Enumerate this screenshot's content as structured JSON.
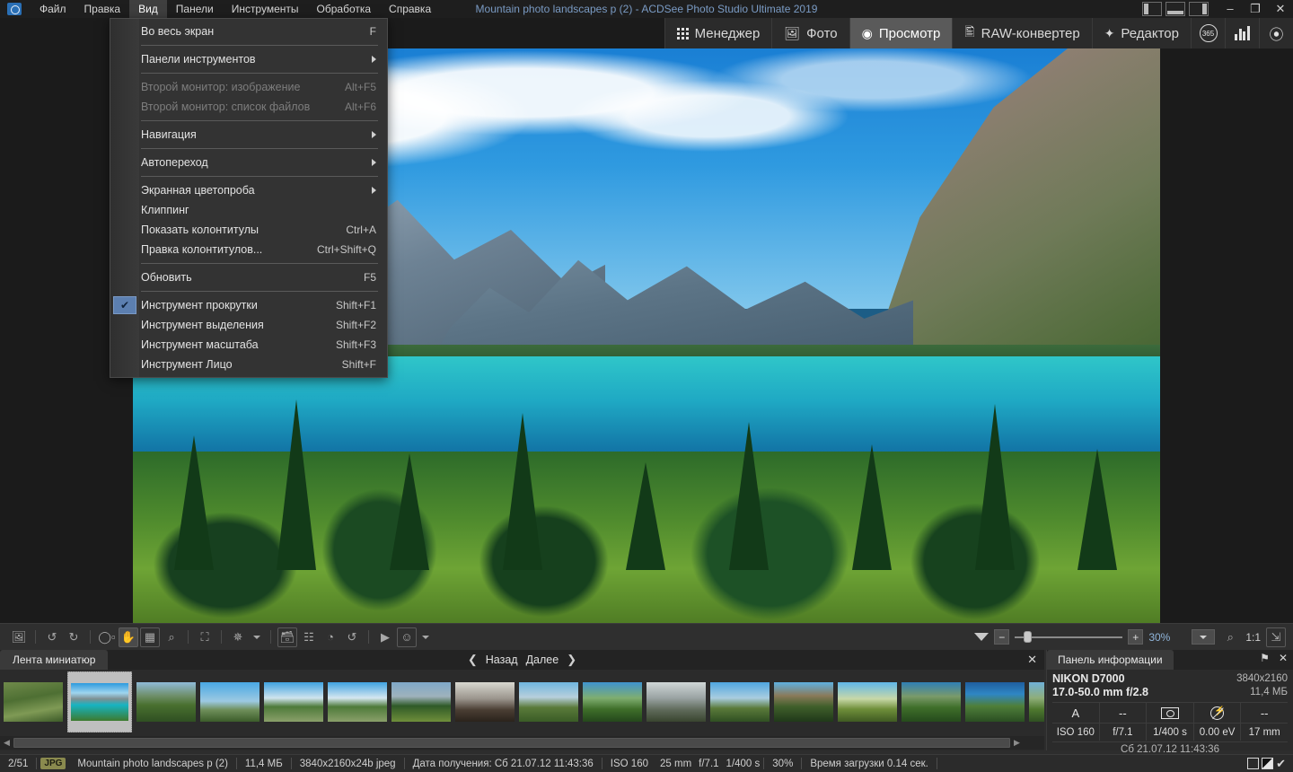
{
  "window": {
    "title": "Mountain photo landscapes p (2) - ACDSee Photo Studio Ultimate 2019",
    "minimize": "–",
    "restore": "❐",
    "close": "✕"
  },
  "menubar": {
    "items": [
      {
        "label": "Файл"
      },
      {
        "label": "Правка"
      },
      {
        "label": "Вид"
      },
      {
        "label": "Панели"
      },
      {
        "label": "Инструменты"
      },
      {
        "label": "Обработка"
      },
      {
        "label": "Справка"
      }
    ]
  },
  "view_menu": {
    "items": [
      {
        "label": "Во весь экран",
        "accel": "F"
      },
      {
        "sep": true
      },
      {
        "label": "Панели инструментов",
        "accel": "",
        "submenu": true
      },
      {
        "sep": true
      },
      {
        "label": "Второй монитор: изображение",
        "accel": "Alt+F5",
        "disabled": true
      },
      {
        "label": "Второй монитор: список файлов",
        "accel": "Alt+F6",
        "disabled": true
      },
      {
        "sep": true
      },
      {
        "label": "Навигация",
        "accel": "",
        "submenu": true
      },
      {
        "sep": true
      },
      {
        "label": "Автопереход",
        "accel": "",
        "submenu": true
      },
      {
        "sep": true
      },
      {
        "label": "Экранная цветопроба",
        "accel": "",
        "submenu": true
      },
      {
        "label": "Клиппинг",
        "accel": ""
      },
      {
        "label": "Показать колонтитулы",
        "accel": "Ctrl+A"
      },
      {
        "label": "Правка колонтитулов...",
        "accel": "Ctrl+Shift+Q"
      },
      {
        "sep": true
      },
      {
        "label": "Обновить",
        "accel": "F5"
      },
      {
        "sep": true
      },
      {
        "label": "Инструмент прокрутки",
        "accel": "Shift+F1",
        "checked": true
      },
      {
        "label": "Инструмент выделения",
        "accel": "Shift+F2"
      },
      {
        "label": "Инструмент масштаба",
        "accel": "Shift+F3"
      },
      {
        "label": "Инструмент Лицо",
        "accel": "Shift+F"
      }
    ],
    "check_glyph": "✔"
  },
  "modes": {
    "tabs": [
      {
        "label": "Менеджер",
        "icon": "grid-icon",
        "selected": false
      },
      {
        "label": "Фото",
        "icon": "photo-stack-icon",
        "selected": false
      },
      {
        "label": "Просмотр",
        "icon": "eye-icon",
        "selected": true
      },
      {
        "label": "RAW-конвертер",
        "icon": "raw-convert-icon",
        "selected": false
      },
      {
        "label": "Редактор",
        "icon": "brush-icon",
        "selected": false
      }
    ],
    "extra_icons": [
      {
        "name": "acdsee-365-icon",
        "glyph": "365"
      },
      {
        "name": "histogram-icon",
        "glyph": "█"
      },
      {
        "name": "quick-view-icon",
        "glyph": "◔"
      }
    ]
  },
  "toolbar": {
    "buttons": [
      {
        "name": "open-image-button",
        "glyph": "ὛC",
        "state": "off"
      },
      {
        "sep": true
      },
      {
        "name": "rotate-left-button",
        "glyph": "↺",
        "state": "off"
      },
      {
        "name": "rotate-right-button",
        "glyph": "↻",
        "state": "off"
      },
      {
        "sep": true
      },
      {
        "name": "crop-button",
        "glyph": "❑",
        "state": "off"
      },
      {
        "name": "pan-tool-button",
        "glyph": "✋",
        "state": "on"
      },
      {
        "name": "select-tool-button",
        "glyph": "⬚",
        "state": "boxed"
      },
      {
        "name": "zoom-tool-button",
        "glyph": "⌕",
        "state": "off"
      },
      {
        "sep": true
      },
      {
        "name": "fit-screen-button",
        "glyph": "⛶",
        "state": "off"
      },
      {
        "sep": true
      },
      {
        "name": "auto-fix-button",
        "glyph": "✨",
        "state": "off",
        "dropdown": true
      },
      {
        "sep": true
      },
      {
        "name": "batch-button",
        "glyph": "὜2",
        "state": "boxed"
      },
      {
        "name": "adjust-sliders-button",
        "glyph": "☷",
        "state": "off"
      },
      {
        "name": "exposure-button",
        "glyph": "◔",
        "state": "off"
      },
      {
        "name": "rotate-refresh-button",
        "glyph": "↻",
        "state": "off"
      },
      {
        "sep": true
      },
      {
        "name": "slideshow-button",
        "glyph": "▶",
        "state": "off"
      },
      {
        "name": "face-tool-button",
        "glyph": "☺",
        "state": "boxed",
        "dropdown": true
      }
    ]
  },
  "zoom": {
    "collapse_name": "collapse-panel-caret",
    "minus": "−",
    "plus": "+",
    "value": "30%",
    "actual_size": "1:1",
    "fit_name": "fit-to-window-button",
    "zoom_out_name": "zoom-out-icon"
  },
  "filmstrip": {
    "tab_label": "Лента миниатюр",
    "prev_label": "Назад",
    "next_label": "Далее",
    "prev_chevron": "❮",
    "next_chevron": "❯",
    "close_glyph": "✕",
    "selected_index": 1,
    "thumbs": [
      {
        "name": "thumb-1",
        "css": "linear-gradient(170deg,#6f8a4a 0%,#4e6f33 40%,#7f9a55 70%,#3c5a28 100%)"
      },
      {
        "name": "thumb-2",
        "css": "linear-gradient(#2d9ade 0%,#9fd5ef 26%,#7d8f92 42%,#17b4c2 58%,#3d7a2e 100%)"
      },
      {
        "name": "thumb-3",
        "css": "linear-gradient(#8fbad8 0%,#6f8f6a 34%,#49702f 58%,#2f4f22 100%)"
      },
      {
        "name": "thumb-4",
        "css": "linear-gradient(#49a8e4 0%,#9cc9e2 48%,#6f8f5a 70%,#3b5c2a 100%)"
      },
      {
        "name": "thumb-5",
        "css": "linear-gradient(#3fa2e0 0%,#cfe4ee 40%,#4e7a3a 62%,#8aa06a 100%)"
      },
      {
        "name": "thumb-6",
        "css": "linear-gradient(#3fa2e0 0%,#d5e7f0 40%,#4e7a3a 62%,#8aa06a 100%)"
      },
      {
        "name": "thumb-7",
        "css": "linear-gradient(#7fa8c8 0%,#9fb2bc 36%,#2f5a28 60%,#6f8f3a 100%)"
      },
      {
        "name": "thumb-8",
        "css": "linear-gradient(#d8d8d0 0%,#9a948c 42%,#4a3e33 70%,#2a231c 100%)"
      },
      {
        "name": "thumb-9",
        "css": "linear-gradient(#6fb5de 0%,#b7cfdc 38%,#5a7a3a 64%,#3a5c26 100%)"
      },
      {
        "name": "thumb-10",
        "css": "linear-gradient(#3f93cf 0%,#7fae70 40%,#3f6f2a 68%,#24471c 100%)"
      },
      {
        "name": "thumb-11",
        "css": "linear-gradient(#cfd6d6 0%,#9aa3a3 40%,#5f6a5a 70%,#39452f 100%)"
      },
      {
        "name": "thumb-12",
        "css": "linear-gradient(#4fa6e0 0%,#a9cde0 40%,#5a7a3a 66%,#2f4f22 100%)"
      },
      {
        "name": "thumb-13",
        "css": "linear-gradient(#5fb0e0 0%,#8a7a5a 34%,#3f5f2a 62%,#20381a 100%)"
      },
      {
        "name": "thumb-14",
        "css": "linear-gradient(#5fb6e8 0%,#c8d8a8 42%,#6f8f3a 68%,#3f5a22 100%)"
      },
      {
        "name": "thumb-15",
        "css": "linear-gradient(#2f7fb5 0%,#7a9a6a 36%,#3f6f2a 64%,#254a1c 100%)"
      },
      {
        "name": "thumb-16",
        "css": "linear-gradient(#1f5f9f 0%,#2f86c4 30%,#4f7f3a 60%,#2a4e22 100%)"
      },
      {
        "name": "thumb-17",
        "css": "linear-gradient(#6fb0d8 0%,#8fae7a 40%,#4f7a2f 68%,#2f4f22 100%)"
      }
    ]
  },
  "info_panel": {
    "tab_label": "Панель информации",
    "pin_glyph": "⚑",
    "close_glyph": "✕",
    "camera": "NIKON D7000",
    "lens": "17.0-50.0 mm f/2.8",
    "dimensions": "3840x2160",
    "filesize": "11,4 МБ",
    "icons": [
      {
        "name": "mode-a-label",
        "glyph": "A"
      },
      {
        "name": "metering-none",
        "glyph": "--"
      },
      {
        "name": "focus-point-icon",
        "glyph": ""
      },
      {
        "name": "flash-off-icon",
        "glyph": ""
      },
      {
        "name": "extra-none",
        "glyph": "--"
      }
    ],
    "exif": [
      {
        "name": "iso-value",
        "value": "ISO 160"
      },
      {
        "name": "aperture-value",
        "value": "f/7.1"
      },
      {
        "name": "shutter-value",
        "value": "1/400 s"
      },
      {
        "name": "exposure-comp-value",
        "value": "0.00 eV"
      },
      {
        "name": "focal-length-value",
        "value": "17 mm"
      }
    ],
    "date": "Сб 21.07.12 11:43:36"
  },
  "statusbar": {
    "counter": "2/51",
    "format_badge": "JPG",
    "filename": "Mountain photo landscapes p (2)",
    "filesize": "11,4 МБ",
    "dimensions": "3840x2160x24b jpeg",
    "date": "Дата получения: Сб 21.07.12 11:43:36",
    "iso": "ISO 160",
    "focal": "25 mm",
    "aperture": "f/7.1",
    "shutter": "1/400 s",
    "zoom": "30%",
    "loadtime": "Время загрузки 0.14 сек.",
    "check_glyph": "✔"
  }
}
